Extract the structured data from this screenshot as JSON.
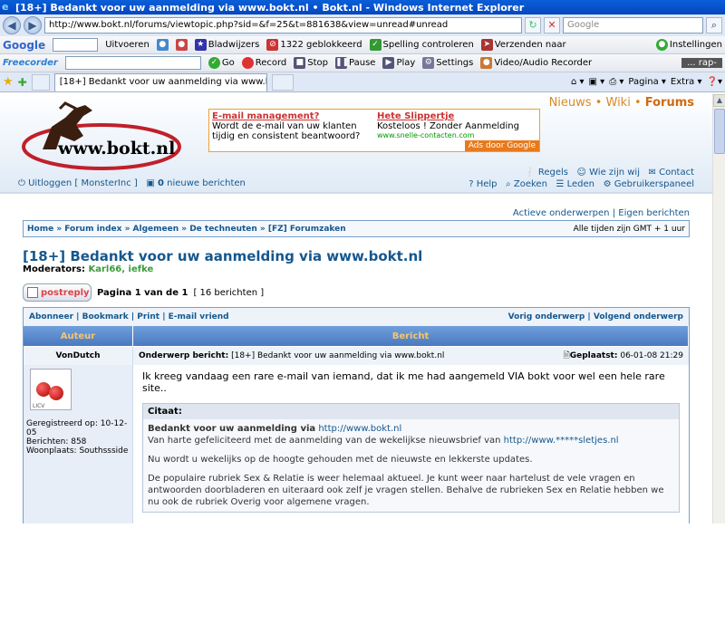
{
  "window": {
    "title": "[18+] Bedankt voor uw aanmelding via www.bokt.nl • Bokt.nl - Windows Internet Explorer"
  },
  "address": {
    "url": "http://www.bokt.nl/forums/viewtopic.php?sid=&f=25&t=881638&view=unread#unread",
    "search_placeholder": "Google"
  },
  "google_toolbar": {
    "brand": "Google",
    "run_label": "Uitvoeren",
    "bookmarks": "Bladwijzers",
    "blocked": "1322 geblokkeerd",
    "spell": "Spelling controleren",
    "send": "Verzenden naar",
    "settings": "Instellingen"
  },
  "freecorder_toolbar": {
    "brand": "Freecorder",
    "go": "Go",
    "record": "Record",
    "stop": "Stop",
    "pause": "Pause",
    "play": "Play",
    "settings": "Settings",
    "recorder": "Video/Audio Recorder",
    "player_text": "... rap-"
  },
  "tabs": [
    {
      "label": "[18+] Bedankt voor uw aanmelding via www.bokt.nl •..."
    }
  ],
  "command_bar": {
    "page": "Pagina",
    "extra": "Extra"
  },
  "site": {
    "logo_text": "www.bokt.nl",
    "topnav": [
      "Nieuws",
      "Wiki",
      "Forums"
    ],
    "ad": {
      "left_title": "E-mail management?",
      "left_text": "Wordt de e-mail van uw klanten tijdig en consistent beantwoord?",
      "right_title": "Hete Slippertje",
      "right_text": "Kosteloos ! Zonder Aanmelding",
      "right_url": "www.snelle-contacten.com",
      "ads_by": "Ads door Google"
    },
    "user_links": [
      "Regels",
      "Wie zijn wij",
      "Contact",
      "Help",
      "Zoeken",
      "Leden",
      "Gebruikerspaneel"
    ],
    "logout": "Uitloggen [ MonsterInc ]",
    "new_count": "0",
    "new_label": "nieuwe berichten"
  },
  "topic": {
    "active_links": "Actieve onderwerpen | Eigen berichten",
    "breadcrumb": "Home » Forum index » Algemeen » De techneuten » [FZ] Forumzaken",
    "timezone": "Alle tijden zijn GMT + 1 uur",
    "title": "[18+] Bedankt voor uw aanmelding via www.bokt.nl",
    "moderators_label": "Moderators:",
    "moderators": "Karl66, iefke",
    "post_reply": "postreply",
    "pagination": "Pagina 1 van de 1",
    "count": "[ 16 berichten ]",
    "tools_left": "Abonneer | Bookmark | Print | E-mail vriend",
    "tools_right": "Vorig onderwerp | Volgend onderwerp",
    "col_author": "Auteur",
    "col_message": "Bericht"
  },
  "post": {
    "author": "VonDutch",
    "subject_label": "Onderwerp bericht:",
    "subject": "[18+] Bedankt voor uw aanmelding via www.bokt.nl",
    "posted_label": "Geplaatst:",
    "posted": "06-01-08 21:29",
    "registered": "Geregistreerd op: 10-12-05",
    "posts": "Berichten: 858",
    "location": "Woonplaats: Southssside",
    "text": "Ik kreeg vandaag een rare e-mail van iemand, dat ik me had aangemeld VIA bokt voor wel een hele rare site..",
    "quote_header": "Citaat:",
    "quote_title": "Bedankt voor uw aanmelding via",
    "quote_title_link": "http://www.bokt.nl",
    "quote_line1": "Van harte gefeliciteerd met de aanmelding van de wekelijkse nieuwsbrief van",
    "quote_line1_link": "http://www.*****sletjes.nl",
    "quote_line2": "Nu wordt u wekelijks op de hoogte gehouden met de nieuwste en lekkerste updates.",
    "quote_line3": "De populaire rubriek Sex & Relatie is weer helemaal aktueel. Je kunt weer naar hartelust de vele vragen en antwoorden doorbladeren en uiteraard ook zelf je vragen stellen. Behalve de rubrieken Sex en Relatie hebben we nu ook de rubriek Overig voor algemene vragen."
  }
}
